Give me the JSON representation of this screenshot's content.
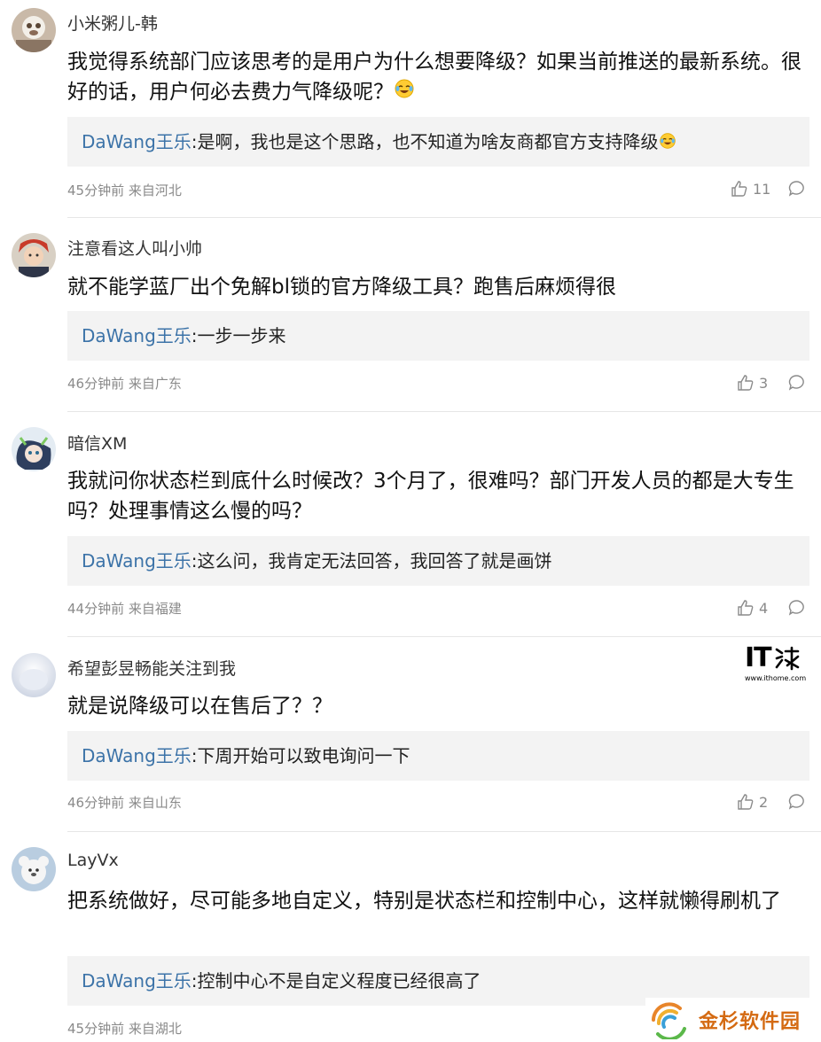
{
  "comments": [
    {
      "username": "小米粥儿-韩",
      "text": "我觉得系统部门应该思考的是用户为什么想要降级？如果当前推送的最新系统。很好的话，用户何必去费力气降级呢？",
      "reply_name": "DaWang王乐",
      "reply_text": ":是啊，我也是这个思路，也不知道为啥友商都官方支持降级",
      "meta": "45分钟前 来自河北",
      "likes": "11"
    },
    {
      "username": "注意看这人叫小帅",
      "text": "就不能学蓝厂出个免解bl锁的官方降级工具？跑售后麻烦得很",
      "reply_name": "DaWang王乐",
      "reply_text": ":一步一步来",
      "meta": "46分钟前 来自广东",
      "likes": "3"
    },
    {
      "username": "暗信XM",
      "text": "我就问你状态栏到底什么时候改？3个月了，很难吗？部门开发人员的都是大专生吗？处理事情这么慢的吗？",
      "reply_name": "DaWang王乐",
      "reply_text": ":这么问，我肯定无法回答，我回答了就是画饼",
      "meta": "44分钟前 来自福建",
      "likes": "4"
    },
    {
      "username": "希望彭昱畅能关注到我",
      "text": "就是说降级可以在售后了？？",
      "reply_name": "DaWang王乐",
      "reply_text": ":下周开始可以致电询问一下",
      "meta": "46分钟前 来自山东",
      "likes": "2"
    },
    {
      "username": "LayVx",
      "text": "把系统做好，尽可能多地自定义，特别是状态栏和控制中心，这样就懒得刷机了",
      "reply_name": "DaWang王乐",
      "reply_text": ":控制中心不是自定义程度已经很高了",
      "meta": "45分钟前 来自湖北",
      "likes": ""
    }
  ],
  "watermarks": {
    "ithome_word": "IT",
    "ithome_site": "www.ithome.com",
    "jinshan_brand": "金杉软件园"
  },
  "colors": {
    "reply_name": "#3c73a8",
    "reply_bg": "#f3f3f3",
    "meta": "#8a8a8a",
    "divider": "#e6e6e6"
  },
  "icons": {
    "like": "thumbs-up-icon",
    "reply": "comment-bubble-icon",
    "emoji": "laughing-tears-emoji-icon"
  }
}
